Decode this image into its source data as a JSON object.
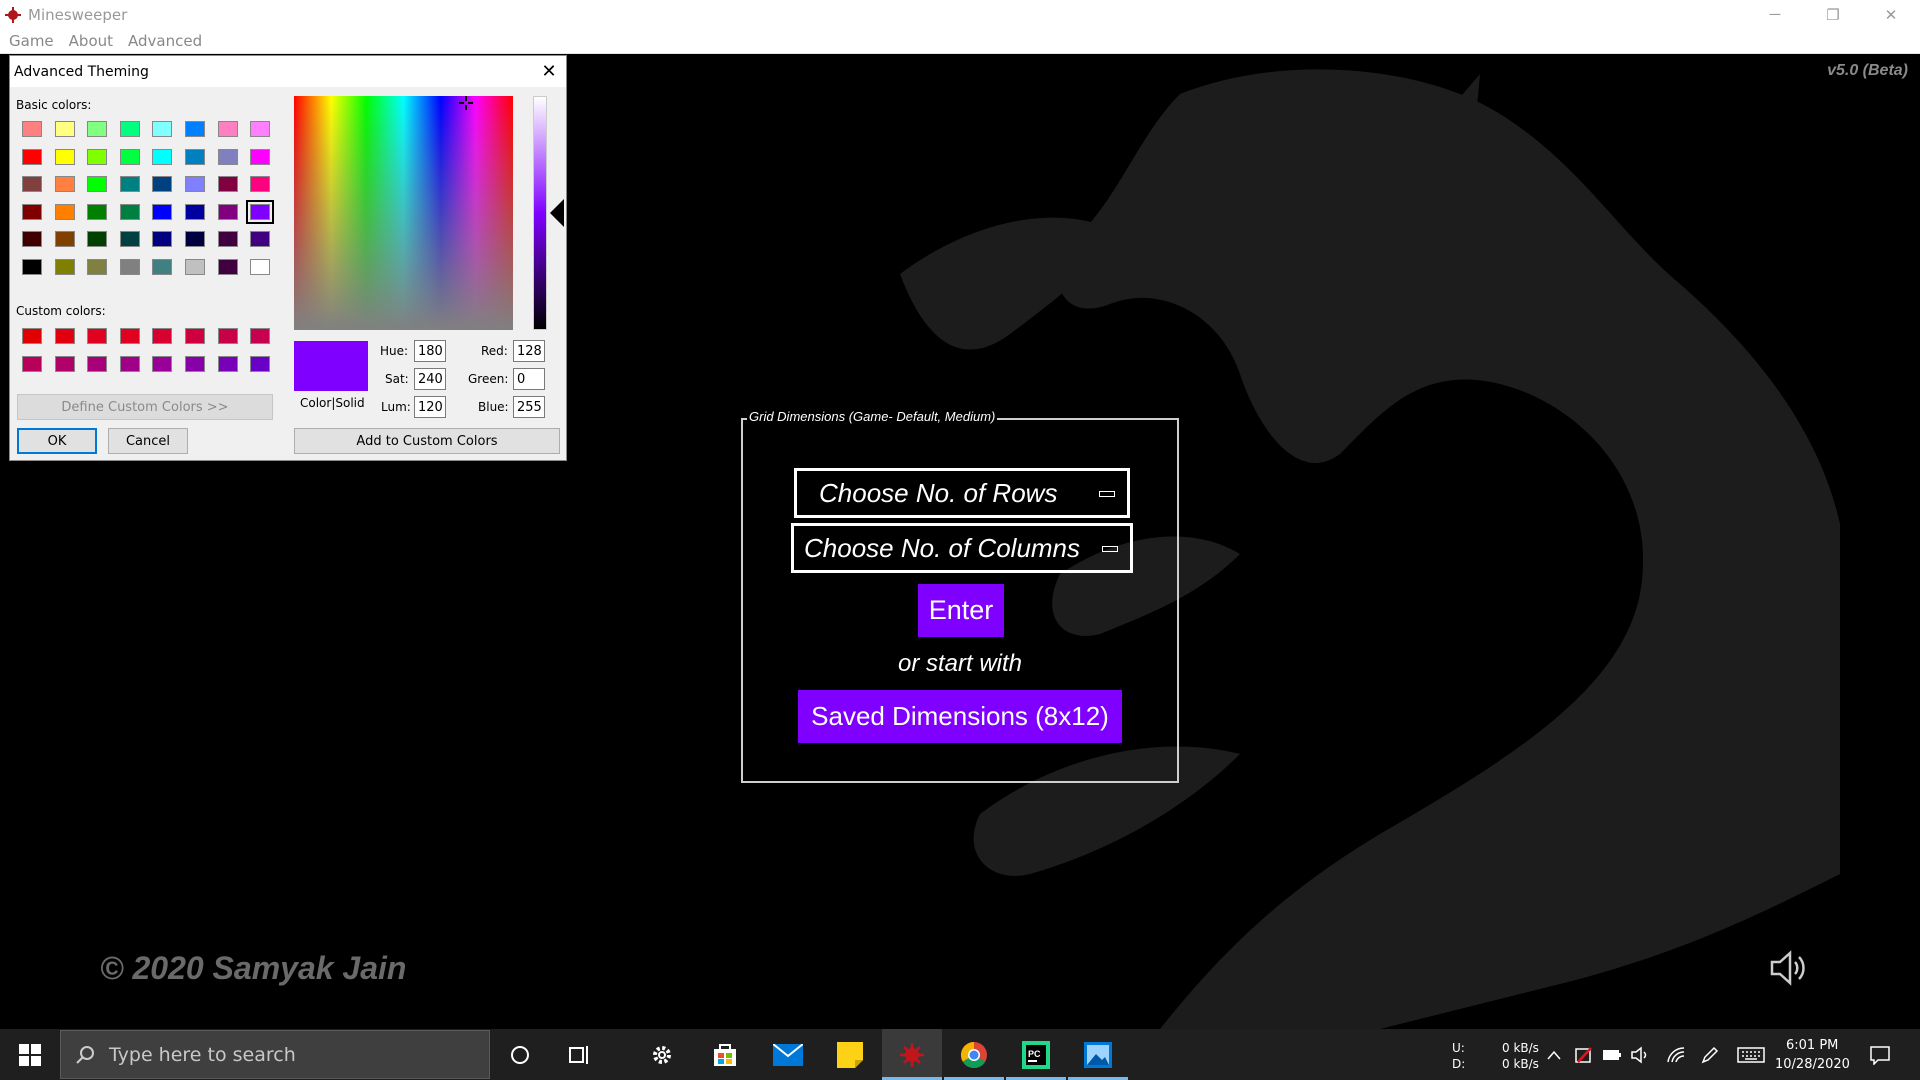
{
  "window": {
    "title": "Minesweeper",
    "controls": {
      "minimize": "─",
      "restore": "❐",
      "close": "✕"
    }
  },
  "menu": [
    "Game",
    "About",
    "Advanced"
  ],
  "main": {
    "version": "v5.0 (Beta)",
    "copyright": "© 2020 Samyak Jain",
    "grid_group": {
      "legend": "Grid Dimensions (Game- Default, Medium)",
      "rows_placeholder": "Choose No. of Rows",
      "cols_placeholder": "Choose No. of Columns",
      "enter_label": "Enter",
      "or_text": "or start with",
      "saved_label": "Saved Dimensions (8x12)"
    },
    "accent_color": "#8000ff"
  },
  "dialog": {
    "title": "Advanced Theming",
    "close_glyph": "✕",
    "basic_colors_label": "Basic colors:",
    "custom_colors_label": "Custom colors:",
    "define_custom_label": "Define Custom Colors >>",
    "ok_label": "OK",
    "cancel_label": "Cancel",
    "add_custom_label": "Add to Custom Colors",
    "color_solid_label": "Color|Solid",
    "fields": {
      "hue": {
        "label": "Hue:",
        "value": "180"
      },
      "sat": {
        "label": "Sat:",
        "value": "240"
      },
      "lum": {
        "label": "Lum:",
        "value": "120"
      },
      "red": {
        "label": "Red:",
        "value": "128"
      },
      "green": {
        "label": "Green:",
        "value": "0"
      },
      "blue": {
        "label": "Blue:",
        "value": "255"
      }
    },
    "basic_colors": [
      [
        "#ff8080",
        "#ffff80",
        "#80ff80",
        "#00ff80",
        "#80ffff",
        "#0080ff",
        "#ff80c0",
        "#ff80ff"
      ],
      [
        "#ff0000",
        "#ffff00",
        "#80ff00",
        "#00ff40",
        "#00ffff",
        "#0080c0",
        "#8080c0",
        "#ff00ff"
      ],
      [
        "#804040",
        "#ff8040",
        "#00ff00",
        "#008080",
        "#004080",
        "#8080ff",
        "#800040",
        "#ff0080"
      ],
      [
        "#800000",
        "#ff8000",
        "#008000",
        "#008040",
        "#0000ff",
        "#0000a0",
        "#800080",
        "#8000ff"
      ],
      [
        "#400000",
        "#804000",
        "#004000",
        "#004040",
        "#000080",
        "#000040",
        "#400040",
        "#400080"
      ],
      [
        "#000000",
        "#808000",
        "#808040",
        "#808080",
        "#408080",
        "#c0c0c0",
        "#400040",
        "#ffffff"
      ]
    ],
    "selected_basic": "#8000ff",
    "custom_colors": [
      [
        "#e00000",
        "#e00010",
        "#e00020",
        "#e00020",
        "#d80030",
        "#d00040",
        "#c80048",
        "#c80050"
      ],
      [
        "#b8005a",
        "#b0006a",
        "#a80078",
        "#a00088",
        "#980098",
        "#8800a8",
        "#7800b8",
        "#6800c8"
      ]
    ]
  },
  "taskbar": {
    "search_placeholder": "Type here to search",
    "net_up_label": "U:",
    "net_down_label": "D:",
    "net_up": "0 kB/s",
    "net_down": "0 kB/s",
    "time": "6:01 PM",
    "date": "10/28/2020"
  }
}
